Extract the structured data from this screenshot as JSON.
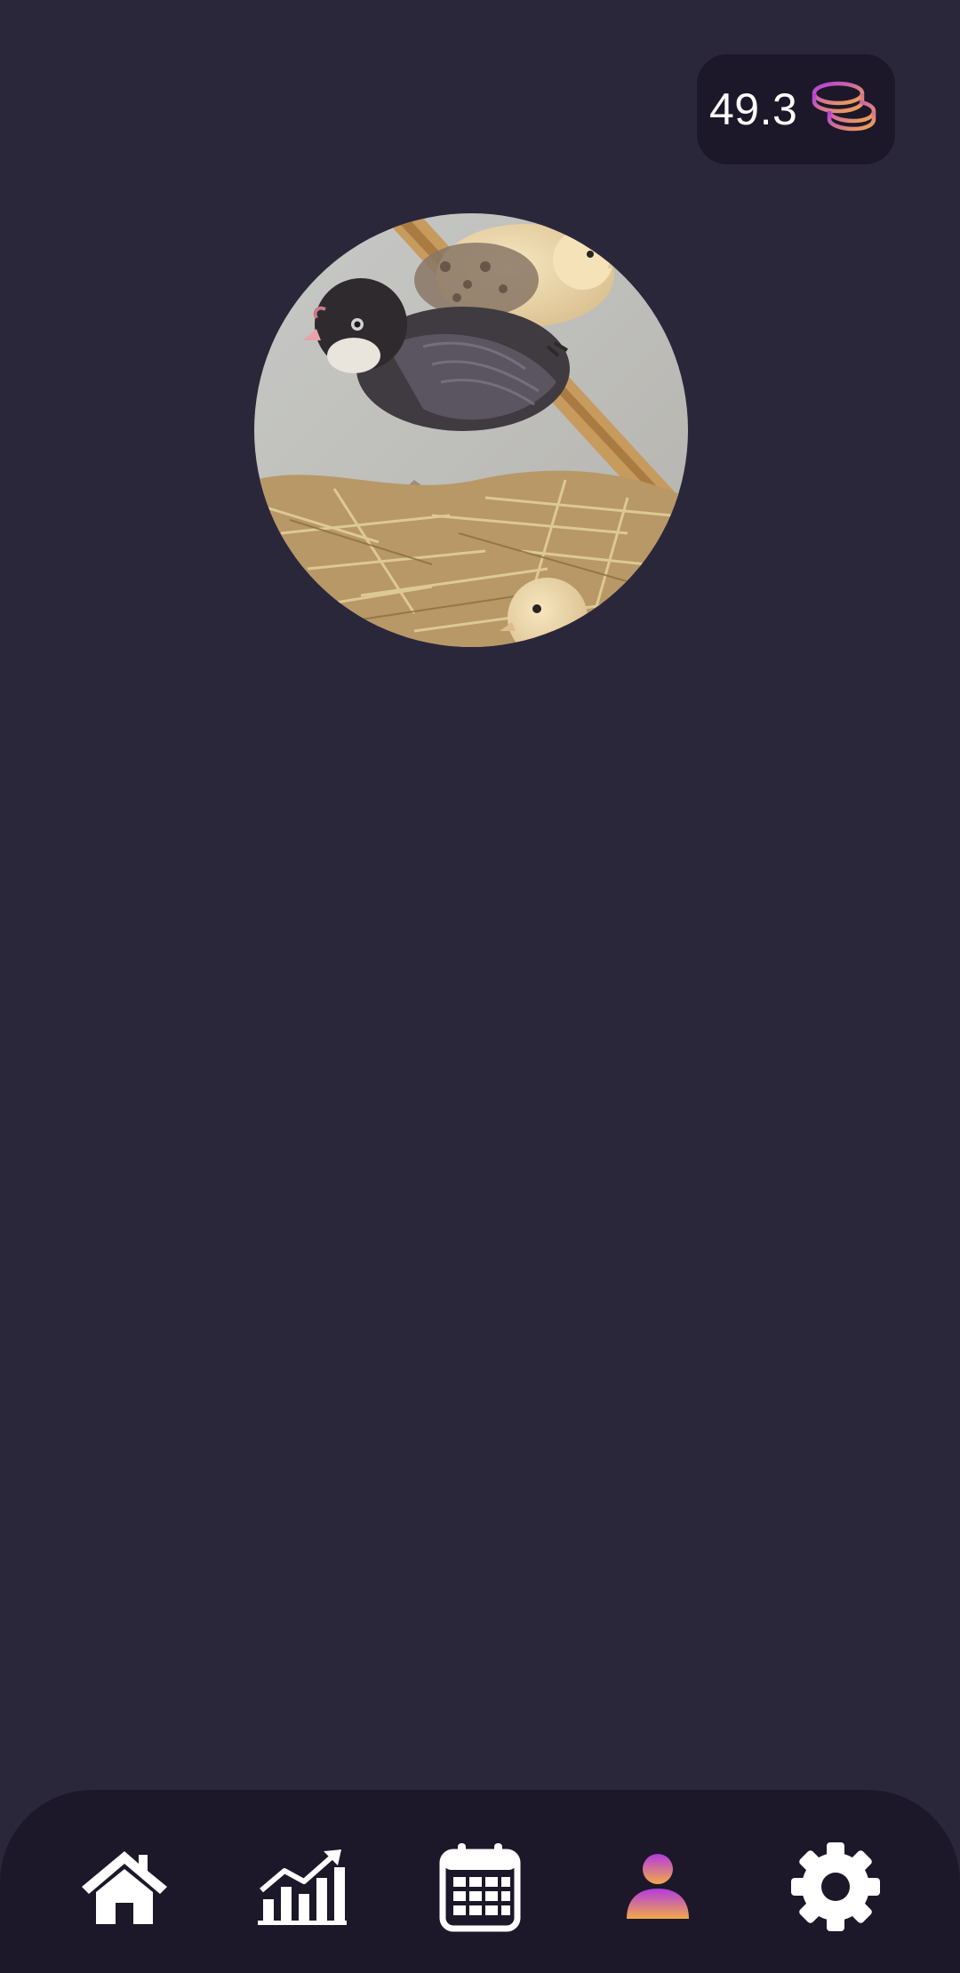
{
  "balance": {
    "value": "49.3",
    "icon": "coins-icon"
  },
  "profile": {
    "avatar_icon": "chick-photo-avatar"
  },
  "bottom_nav": {
    "items": [
      {
        "icon": "home-icon",
        "active": false
      },
      {
        "icon": "chart-icon",
        "active": false
      },
      {
        "icon": "calendar-icon",
        "active": false
      },
      {
        "icon": "profile-icon",
        "active": true
      },
      {
        "icon": "gear-icon",
        "active": false
      }
    ]
  },
  "colors": {
    "background": "#2b273b",
    "surface": "#1c1829",
    "accent_start": "#b23be0",
    "accent_end": "#f2a94a",
    "icon": "#ffffff"
  }
}
